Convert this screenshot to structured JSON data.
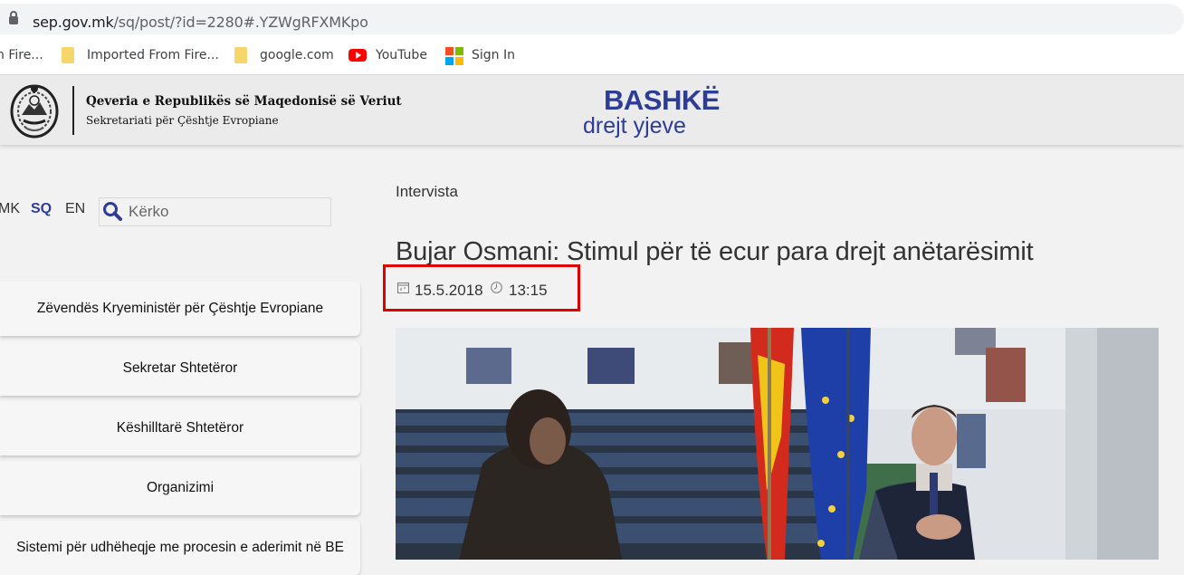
{
  "browser": {
    "url_host": "sep.gov.mk",
    "url_path": "/sq/post/?id=2280#.YZWgRFXMKpo",
    "bookmarks": [
      {
        "label": "n Fire..."
      },
      {
        "label": "Imported From Fire..."
      },
      {
        "label": "google.com"
      },
      {
        "label": "YouTube"
      },
      {
        "label": "Sign In"
      }
    ]
  },
  "header": {
    "gov_title": "Qeveria e Republikës së Maqedonisë së Veriut",
    "gov_subtitle": "Sekretariati për Çështje Evropiane",
    "slogan_main": "BASHKË",
    "slogan_sub": "drejt yjeve",
    "brand_color": "#2d3d96"
  },
  "languages": [
    {
      "code": "MK"
    },
    {
      "code": "SQ",
      "active": true
    },
    {
      "code": "EN"
    }
  ],
  "search": {
    "placeholder": "Kërko",
    "value": ""
  },
  "nav": [
    {
      "label": "Zëvendës Kryeministër për Çështje Evropiane"
    },
    {
      "label": "Sekretar Shtetëror"
    },
    {
      "label": "Këshilltarë Shtetëror"
    },
    {
      "label": "Organizimi"
    },
    {
      "label": "Sistemi për udhëheqje me procesin e aderimit në BE"
    }
  ],
  "article": {
    "category": "Intervista",
    "title": "Bujar Osmani: Stimul për të ecur para drejt anëtarësimit",
    "date": "15.5.2018",
    "time": "13:15",
    "highlight_color": "#e00000"
  },
  "icons": {
    "lock": "lock-icon",
    "folder": "folder-icon",
    "youtube": "youtube-icon",
    "microsoft": "microsoft-icon",
    "search": "magnifier-icon",
    "calendar": "calendar-icon",
    "clock": "clock-icon"
  }
}
